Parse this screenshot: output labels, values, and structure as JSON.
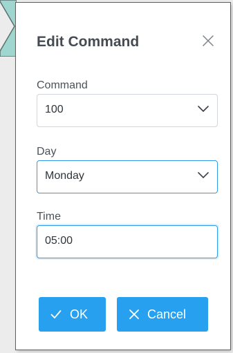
{
  "dialog": {
    "title": "Edit Command"
  },
  "fields": {
    "command": {
      "label": "Command",
      "value": "100"
    },
    "day": {
      "label": "Day",
      "value": "Monday"
    },
    "time": {
      "label": "Time",
      "value": "05:00"
    }
  },
  "actions": {
    "ok_label": "OK",
    "cancel_label": "Cancel"
  },
  "colors": {
    "accent": "#27a1ef",
    "focus_border": "#2f9ae7",
    "title_text": "#444b52",
    "label_text": "#4b5257"
  },
  "icons": {
    "close": "close-icon",
    "dropdown": "chevron-down-icon",
    "ok": "checkmark-icon",
    "cancel": "close-icon"
  }
}
